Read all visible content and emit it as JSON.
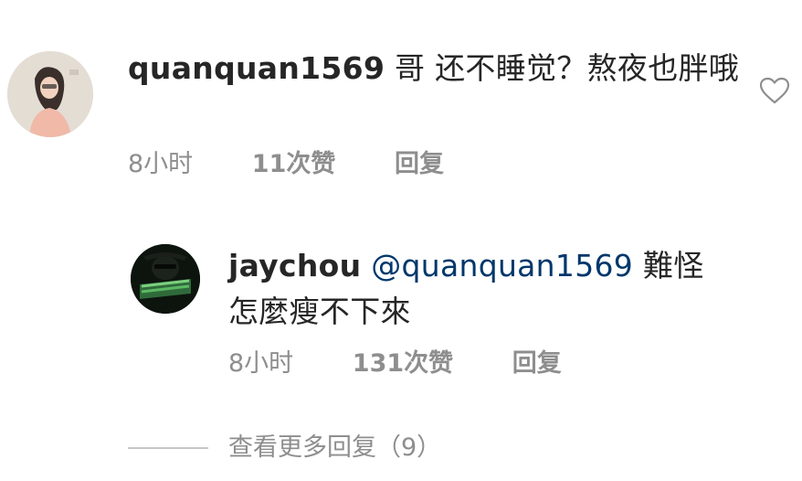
{
  "main_comment": {
    "username": "quanquan1569",
    "text": "哥 还不睡觉？熬夜也胖哦",
    "time": "8小时",
    "likes": "11次赞",
    "reply_label": "回复"
  },
  "reply_comment": {
    "username": "jaychou",
    "mention": "@quanquan1569",
    "text": "難怪怎麼瘦不下來",
    "time": "8小时",
    "likes": "131次赞",
    "reply_label": "回复"
  },
  "more_replies": {
    "label": "查看更多回复（9）"
  },
  "icons": {
    "like": "heart-outline-icon"
  },
  "colors": {
    "text": "#262626",
    "secondary": "#8e8e8e",
    "mention": "#00376b",
    "divider": "#c7c7c7"
  }
}
